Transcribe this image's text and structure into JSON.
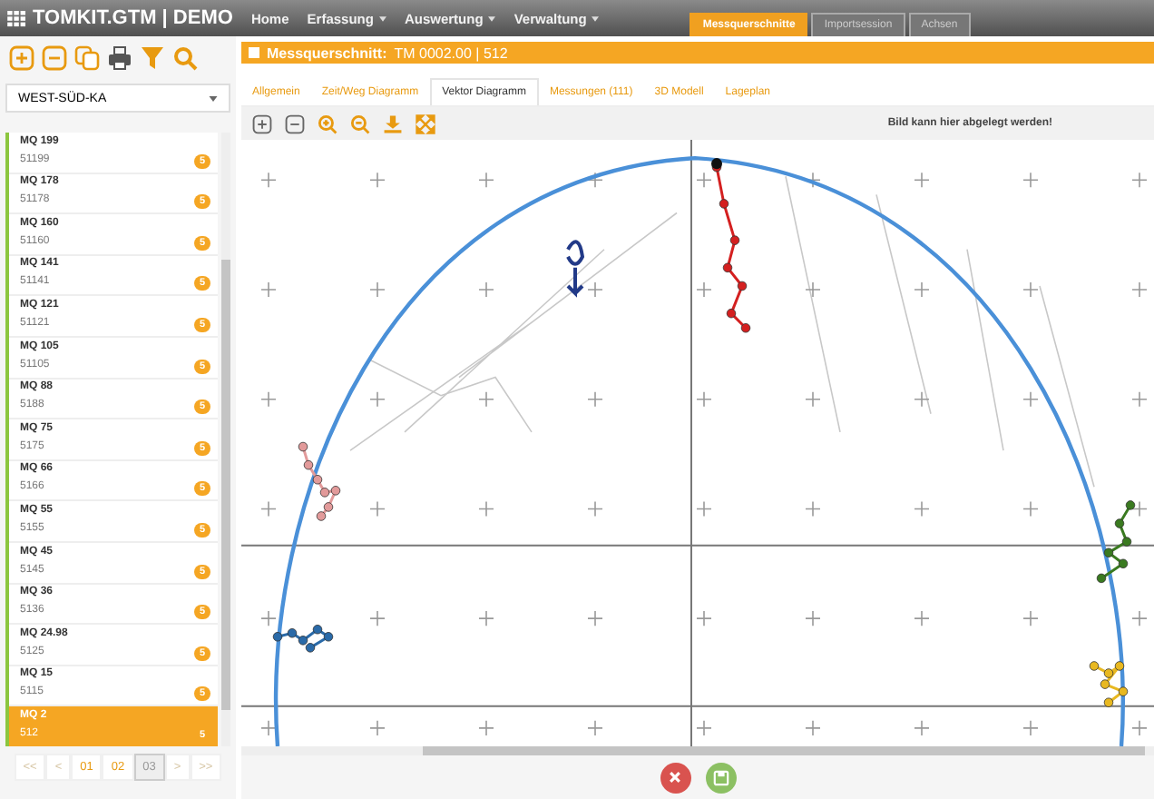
{
  "app": {
    "title": "TOMKIT.GTM | DEMO"
  },
  "menu": [
    {
      "label": "Home",
      "dropdown": false
    },
    {
      "label": "Erfassung",
      "dropdown": true
    },
    {
      "label": "Auswertung",
      "dropdown": true
    },
    {
      "label": "Verwaltung",
      "dropdown": true
    }
  ],
  "window_tabs": [
    {
      "label": "Messquerschnitte",
      "selected": true
    },
    {
      "label": "Importsession",
      "selected": false
    },
    {
      "label": "Achsen",
      "selected": false
    }
  ],
  "sidebar": {
    "filter": {
      "value": "WEST-SÜD-KA"
    },
    "items": [
      {
        "name": "MQ 199",
        "code": "51199",
        "badge": "5",
        "selected": false
      },
      {
        "name": "MQ 178",
        "code": "51178",
        "badge": "5",
        "selected": false
      },
      {
        "name": "MQ 160",
        "code": "51160",
        "badge": "5",
        "selected": false
      },
      {
        "name": "MQ 141",
        "code": "51141",
        "badge": "5",
        "selected": false
      },
      {
        "name": "MQ 121",
        "code": "51121",
        "badge": "5",
        "selected": false
      },
      {
        "name": "MQ 105",
        "code": "51105",
        "badge": "5",
        "selected": false
      },
      {
        "name": "MQ 88",
        "code": "5188",
        "badge": "5",
        "selected": false
      },
      {
        "name": "MQ 75",
        "code": "5175",
        "badge": "5",
        "selected": false
      },
      {
        "name": "MQ 66",
        "code": "5166",
        "badge": "5",
        "selected": false
      },
      {
        "name": "MQ 55",
        "code": "5155",
        "badge": "5",
        "selected": false
      },
      {
        "name": "MQ 45",
        "code": "5145",
        "badge": "5",
        "selected": false
      },
      {
        "name": "MQ 36",
        "code": "5136",
        "badge": "5",
        "selected": false
      },
      {
        "name": "MQ 24.98",
        "code": "5125",
        "badge": "5",
        "selected": false
      },
      {
        "name": "MQ 15",
        "code": "5115",
        "badge": "5",
        "selected": false
      },
      {
        "name": "MQ 2",
        "code": "512",
        "badge": "5",
        "selected": true
      }
    ],
    "pagination": [
      {
        "label": "<<",
        "selected": false,
        "disabled": true
      },
      {
        "label": "<",
        "selected": false,
        "disabled": true
      },
      {
        "label": "01",
        "selected": false,
        "disabled": false
      },
      {
        "label": "02",
        "selected": false,
        "disabled": false
      },
      {
        "label": "03",
        "selected": true,
        "disabled": false
      },
      {
        "label": ">",
        "selected": false,
        "disabled": true
      },
      {
        "label": ">>",
        "selected": false,
        "disabled": true
      }
    ]
  },
  "panel": {
    "title": "Messquerschnitt:",
    "subtitle": "TM 0002.00 | 512",
    "tabs": [
      {
        "label": "Allgemein",
        "selected": false
      },
      {
        "label": "Zeit/Weg Diagramm",
        "selected": false
      },
      {
        "label": "Vektor Diagramm",
        "selected": true
      },
      {
        "label": "Messungen (111)",
        "selected": false
      },
      {
        "label": "3D Modell",
        "selected": false
      },
      {
        "label": "Lageplan",
        "selected": false
      }
    ],
    "drop_hint": "Bild kann hier abgelegt werden!"
  }
}
